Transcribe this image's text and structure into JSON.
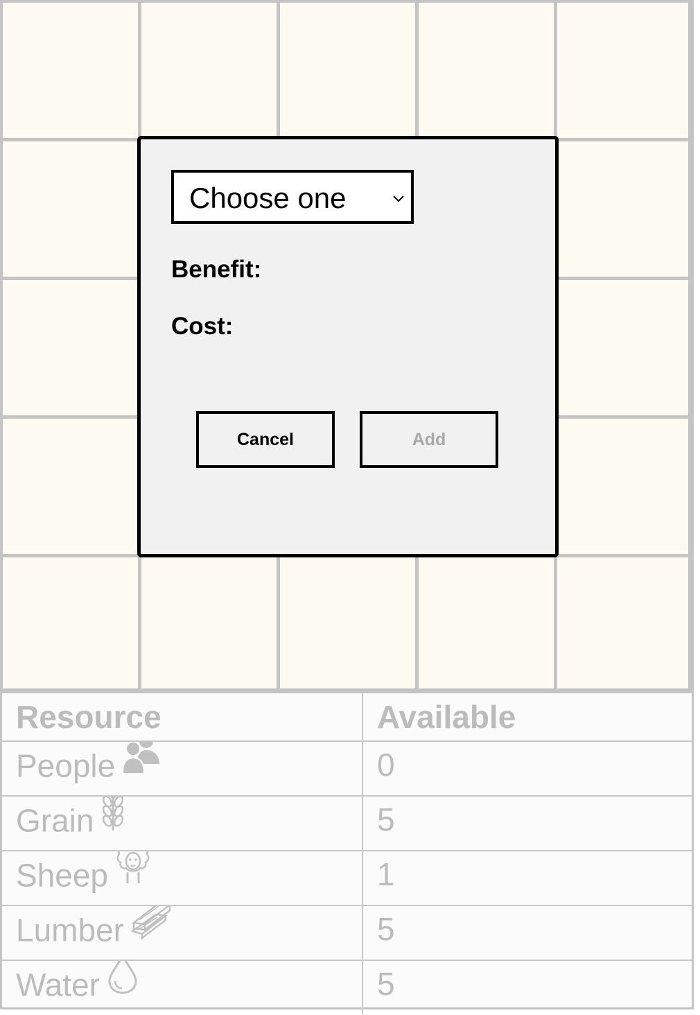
{
  "dialog": {
    "select": {
      "value": "Choose one"
    },
    "benefit_label": "Benefit:",
    "benefit_value": "",
    "cost_label": "Cost:",
    "cost_value": "",
    "cancel_label": "Cancel",
    "add_label": "Add",
    "add_enabled": false
  },
  "resources": {
    "header": {
      "resource": "Resource",
      "available": "Available"
    },
    "rows": [
      {
        "name": "People",
        "icon": "people-icon",
        "available": "0"
      },
      {
        "name": "Grain",
        "icon": "grain-icon",
        "available": "5"
      },
      {
        "name": "Sheep",
        "icon": "sheep-icon",
        "available": "1"
      },
      {
        "name": "Lumber",
        "icon": "lumber-icon",
        "available": "5"
      },
      {
        "name": "Water",
        "icon": "water-icon",
        "available": "5"
      }
    ]
  },
  "colors": {
    "cell": "#fdfbf1",
    "grid_line": "#c4c4c4",
    "dialog_bg": "#f1f1f1",
    "disabled_text": "#a8a8a8",
    "table_text": "#bcbcbc"
  }
}
